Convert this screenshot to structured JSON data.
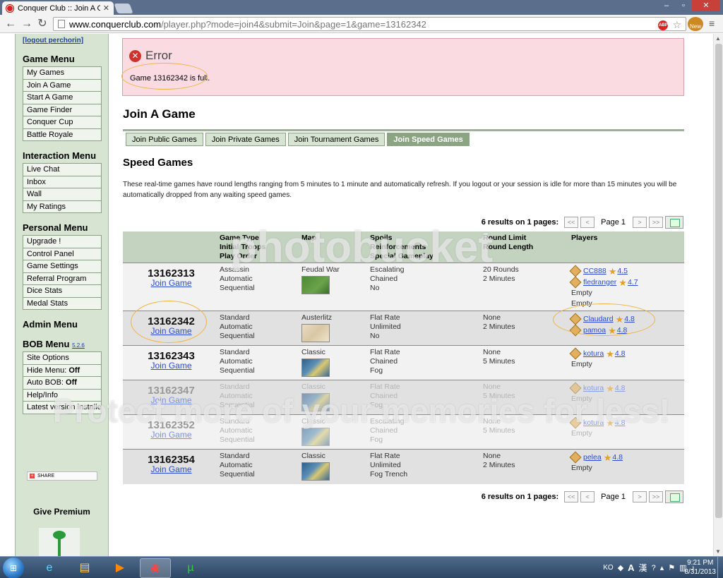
{
  "browser": {
    "tab_title": "Conquer Club :: Join A Ga",
    "url_host": "www.conquerclub.com",
    "url_path": "/player.php?mode=join4&submit=Join&page=1&game=13162342",
    "ext_badge": "New"
  },
  "sidebar": {
    "logout_label": "[logout perchorin]",
    "game_menu": {
      "title": "Game Menu",
      "items": [
        "My Games",
        "Join A Game",
        "Start A Game",
        "Game Finder",
        "Conquer Cup",
        "Battle Royale"
      ]
    },
    "interaction_menu": {
      "title": "Interaction Menu",
      "items": [
        "Live Chat",
        "Inbox",
        "Wall",
        "My Ratings"
      ]
    },
    "personal_menu": {
      "title": "Personal Menu",
      "items": [
        "Upgrade !",
        "Control Panel",
        "Game Settings",
        "Referral Program",
        "Dice Stats",
        "Medal Stats"
      ]
    },
    "admin_menu": {
      "title": "Admin Menu"
    },
    "bob_menu": {
      "title": "BOB Menu",
      "version": "5.2.6",
      "site_options": "Site Options",
      "hide_menu_label": "Hide Menu:",
      "hide_menu_value": "Off",
      "auto_bob_label": "Auto BOB:",
      "auto_bob_value": "Off",
      "help_info": "Help/Info",
      "latest_version": "Latest version installed"
    },
    "share_label": "SHARE",
    "give_premium": "Give Premium"
  },
  "error": {
    "title": "Error",
    "message": "Game 13162342 is full."
  },
  "page_title": "Join A Game",
  "tabs": [
    {
      "label": "Join Public Games",
      "active": false
    },
    {
      "label": "Join Private Games",
      "active": false
    },
    {
      "label": "Join Tournament Games",
      "active": false
    },
    {
      "label": "Join Speed Games",
      "active": true
    }
  ],
  "section_title": "Speed Games",
  "intro_text": "These real-time games have round lengths ranging from 5 minutes to 1 minute and automatically refresh. If you logout or your session is idle for more than 15 minutes you will be automatically dropped from any waiting speed games.",
  "pager": {
    "results_text": "6 results on 1 pages:",
    "first": "<<",
    "prev": "<",
    "page_label": "Page 1",
    "next": ">",
    "last": ">>"
  },
  "table": {
    "headers": {
      "type": [
        "Game Type",
        "Initial Troops",
        "Play Order"
      ],
      "map": "Map",
      "spoils": [
        "Spoils",
        "Reinforcements",
        "Special Gameplay"
      ],
      "round": [
        "Round Limit",
        "Round Length"
      ],
      "players": "Players"
    },
    "join_label": "Join Game",
    "empty_label": "Empty",
    "games": [
      {
        "id": "13162313",
        "faded": false,
        "type": [
          "Assassin",
          "Automatic",
          "Sequential"
        ],
        "map": "Feudal War",
        "map_style": "feudal",
        "spoils": [
          "Escalating",
          "Chained",
          "No"
        ],
        "round": [
          "20 Rounds",
          "2 Minutes"
        ],
        "players": [
          {
            "name": "CC888",
            "rating": "4.5"
          },
          {
            "name": "fledranger",
            "rating": "4.7"
          }
        ],
        "empty_slots": 2
      },
      {
        "id": "13162342",
        "faded": false,
        "type": [
          "Standard",
          "Automatic",
          "Sequential"
        ],
        "map": "Austerlitz",
        "map_style": "austerlitz",
        "spoils": [
          "Flat Rate",
          "Unlimited",
          "No"
        ],
        "round": [
          "None",
          "2 Minutes"
        ],
        "players": [
          {
            "name": "Claudard",
            "rating": "4.8"
          },
          {
            "name": "pamoa",
            "rating": "4.8"
          }
        ],
        "empty_slots": 0
      },
      {
        "id": "13162343",
        "faded": false,
        "type": [
          "Standard",
          "Automatic",
          "Sequential"
        ],
        "map": "Classic",
        "map_style": "classic",
        "spoils": [
          "Flat Rate",
          "Chained",
          "Fog"
        ],
        "round": [
          "None",
          "5 Minutes"
        ],
        "players": [
          {
            "name": "kotura",
            "rating": "4.8"
          }
        ],
        "empty_slots": 1
      },
      {
        "id": "13162347",
        "faded": true,
        "type": [
          "Standard",
          "Automatic",
          "Sequential"
        ],
        "map": "Classic",
        "map_style": "classic",
        "spoils": [
          "Flat Rate",
          "Chained",
          "Fog"
        ],
        "round": [
          "None",
          "5 Minutes"
        ],
        "players": [
          {
            "name": "kotura",
            "rating": "4.8"
          }
        ],
        "empty_slots": 1
      },
      {
        "id": "13162352",
        "faded": true,
        "type": [
          "Standard",
          "Automatic",
          "Sequential"
        ],
        "map": "Classic",
        "map_style": "classic",
        "spoils": [
          "Escalating",
          "Chained",
          "Fog"
        ],
        "round": [
          "None",
          "5 Minutes"
        ],
        "players": [
          {
            "name": "kotura",
            "rating": "4.8"
          }
        ],
        "empty_slots": 1
      },
      {
        "id": "13162354",
        "faded": false,
        "type": [
          "Standard",
          "Automatic",
          "Sequential"
        ],
        "map": "Classic",
        "map_style": "classic",
        "spoils": [
          "Flat Rate",
          "Unlimited",
          "Fog Trench"
        ],
        "round": [
          "None",
          "2 Minutes"
        ],
        "players": [
          {
            "name": "pelea",
            "rating": "4.8"
          }
        ],
        "empty_slots": 1
      }
    ]
  },
  "watermark": {
    "line1": "photobucket",
    "line2": "Protect more of your memories for less!"
  },
  "taskbar": {
    "lang": "KO",
    "ime": "A",
    "hanja": "漢",
    "time": "9:21 PM",
    "date": "8/31/2013"
  },
  "colors": {
    "sidebar_bg": "#d6e4d1",
    "error_bg": "#fadbe1",
    "active_tab": "#8ba482",
    "link": "#2a4bcf"
  }
}
